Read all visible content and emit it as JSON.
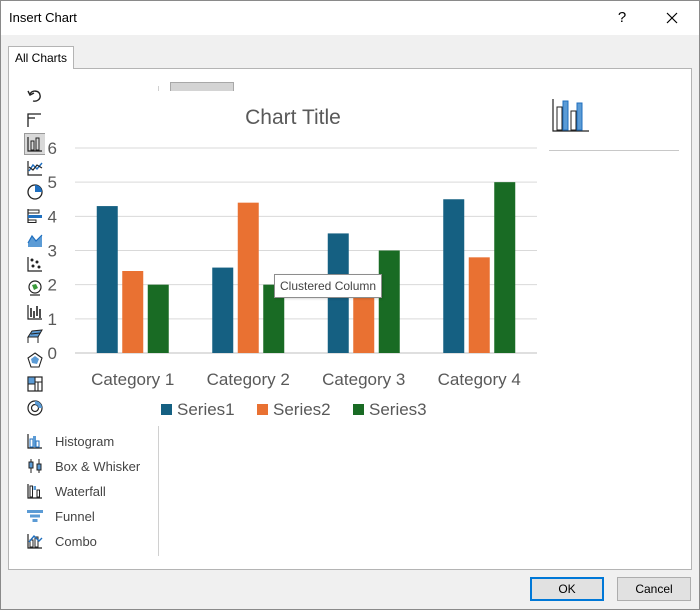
{
  "window": {
    "title": "Insert Chart",
    "help_label": "?"
  },
  "tabs": [
    {
      "label": "All Charts"
    }
  ],
  "sidebar": {
    "items": [
      {
        "label": "",
        "icon": "undo-icon"
      },
      {
        "label": "",
        "icon": "template-icon"
      },
      {
        "label": "",
        "icon": "column-chart-icon"
      },
      {
        "label": "",
        "icon": "line-chart-icon"
      },
      {
        "label": "",
        "icon": "pie-chart-icon"
      },
      {
        "label": "",
        "icon": "bar-chart-icon"
      },
      {
        "label": "",
        "icon": "area-chart-icon"
      },
      {
        "label": "",
        "icon": "scatter-chart-icon"
      },
      {
        "label": "",
        "icon": "map-chart-icon"
      },
      {
        "label": "",
        "icon": "stock-chart-icon"
      },
      {
        "label": "",
        "icon": "surface-chart-icon"
      },
      {
        "label": "",
        "icon": "radar-chart-icon"
      },
      {
        "label": "",
        "icon": "treemap-chart-icon"
      },
      {
        "label": "",
        "icon": "sunburst-chart-icon"
      },
      {
        "label": "Histogram",
        "icon": "histogram-chart-icon"
      },
      {
        "label": "Box & Whisker",
        "icon": "box-whisker-chart-icon"
      },
      {
        "label": "Waterfall",
        "icon": "waterfall-chart-icon"
      },
      {
        "label": "Funnel",
        "icon": "funnel-chart-icon"
      },
      {
        "label": "Combo",
        "icon": "combo-chart-icon"
      }
    ]
  },
  "tooltip": {
    "text": "Clustered Column"
  },
  "buttons": {
    "ok_label": "OK",
    "cancel_label": "Cancel"
  },
  "colors": {
    "series1": "#156082",
    "series2": "#E97132",
    "series3": "#196B24",
    "accent": "#0078D7"
  },
  "chart_data": {
    "type": "bar",
    "title": "Chart Title",
    "categories": [
      "Category 1",
      "Category 2",
      "Category 3",
      "Category 4"
    ],
    "series": [
      {
        "name": "Series1",
        "values": [
          4.3,
          2.5,
          3.5,
          4.5
        ]
      },
      {
        "name": "Series2",
        "values": [
          2.4,
          4.4,
          1.8,
          2.8
        ]
      },
      {
        "name": "Series3",
        "values": [
          2.0,
          2.0,
          3.0,
          5.0
        ]
      }
    ],
    "yticks": [
      "0",
      "1",
      "2",
      "3",
      "4",
      "5",
      "6"
    ],
    "ylim": [
      0,
      6
    ],
    "grid": true,
    "legend": "bottom"
  }
}
